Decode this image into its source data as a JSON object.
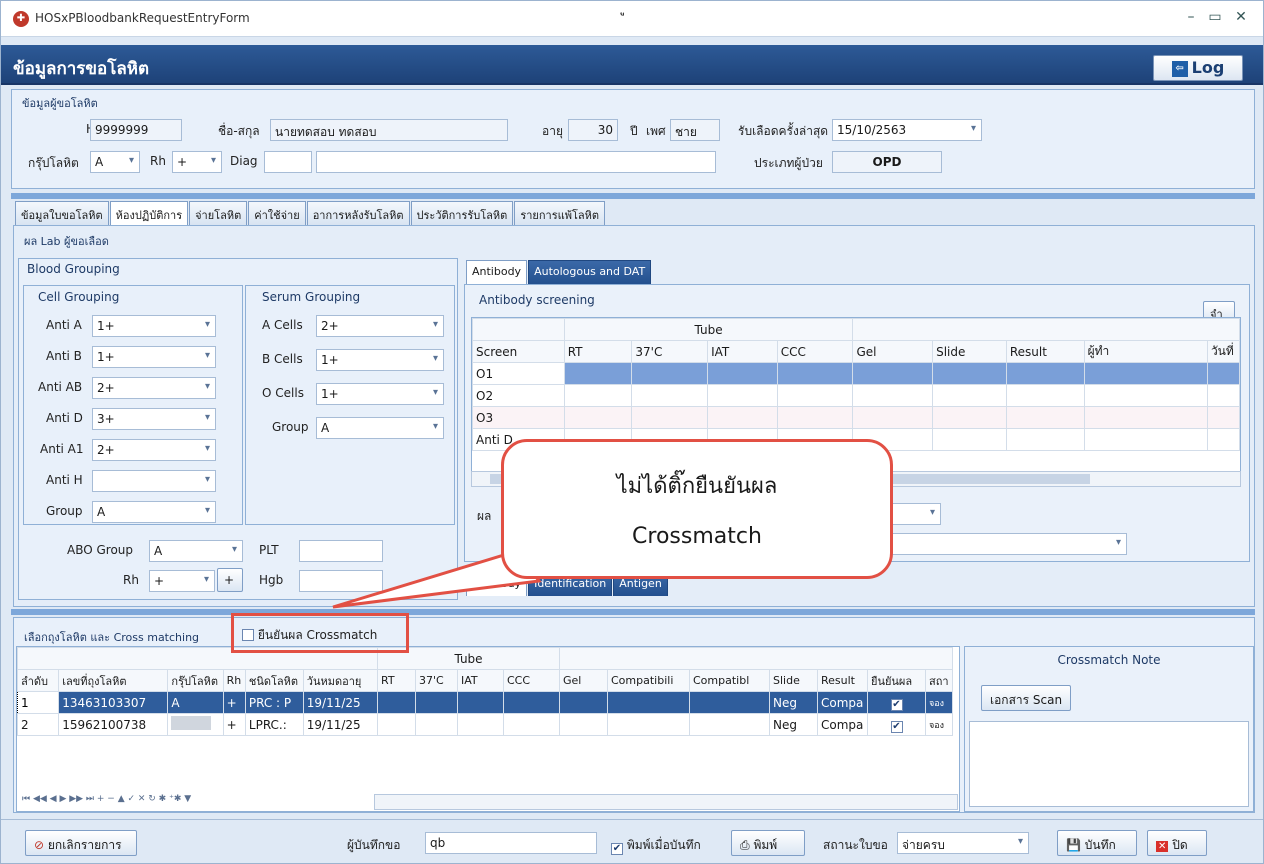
{
  "window": {
    "title": "HOSxPBloodbankRequestEntryForm",
    "top_mark": "ู"
  },
  "banner": {
    "title": "ข้อมูลการขอโลหิต",
    "log_label": "Log",
    "log_icon": "exit-icon"
  },
  "patient": {
    "group_title": "ข้อมูลผู้ขอโลหิต",
    "hn_label": "HN",
    "hn": "9999999",
    "name_label": "ชื่อ-สกุล",
    "name": "นายทดสอบ ทดสอบ",
    "age_label": "อายุ",
    "age": "30",
    "age_unit": "ปี",
    "sex_label": "เพศ",
    "sex": "ชาย",
    "last_label": "รับเลือดครั้งล่าสุด",
    "last_date": "15/10/2563",
    "blood_label": "กรุ๊ปโลหิต",
    "blood": "A",
    "rh_label": "Rh",
    "rh": "+",
    "diag_label": "Diag",
    "ptype_label": "ประเภทผู้ป่วย",
    "ptype": "OPD"
  },
  "main_tabs": [
    {
      "label": "ข้อมูลใบขอโลหิต"
    },
    {
      "label": "ห้องปฏิบัติการ"
    },
    {
      "label": "จ่ายโลหิต"
    },
    {
      "label": "ค่าใช้จ่าย"
    },
    {
      "label": "อาการหลังรับโลหิต"
    },
    {
      "label": "ประวัติการรับโลหิต"
    },
    {
      "label": "รายการแพ้โลหิต"
    }
  ],
  "lab": {
    "title": "ผล Lab ผู้ขอเลือด",
    "blood_grouping": "Blood Grouping",
    "cell_grouping": "Cell Grouping",
    "serum_grouping": "Serum Grouping",
    "cell": [
      {
        "label": "Anti A",
        "value": "1+"
      },
      {
        "label": "Anti B",
        "value": "1+"
      },
      {
        "label": "Anti AB",
        "value": "2+"
      },
      {
        "label": "Anti D",
        "value": "3+"
      },
      {
        "label": "Anti A1",
        "value": "2+"
      },
      {
        "label": "Anti H",
        "value": ""
      },
      {
        "label": "Group",
        "value": "A"
      }
    ],
    "serum": [
      {
        "label": "A Cells",
        "value": "2+"
      },
      {
        "label": "B Cells",
        "value": "1+"
      },
      {
        "label": "O Cells",
        "value": "1+"
      },
      {
        "label": "Group",
        "value": "A"
      }
    ],
    "abo_label": "ABO Group",
    "abo": "A",
    "rh_label": "Rh",
    "rh": "+",
    "rh_btn": "+",
    "plt_label": "PLT",
    "hgb_label": "Hgb"
  },
  "antibody": {
    "tabs": [
      {
        "label": "Antibody"
      },
      {
        "label": "Autologous and DAT"
      }
    ],
    "screen_title": "Antibody screening",
    "side_btn": "จำ",
    "tube_header": "Tube",
    "columns": [
      "Screen",
      "RT",
      "37'C",
      "IAT",
      "CCC",
      "Gel",
      "Slide",
      "Result",
      "ผู้ทำ",
      "วันที่"
    ],
    "rows": [
      "O1",
      "O2",
      "O3",
      "Anti D"
    ],
    "result_label": "ผล",
    "bottom_tabs": [
      {
        "label": "Antibody"
      },
      {
        "label": "Identification"
      },
      {
        "label": "Antigen"
      }
    ]
  },
  "callout": {
    "line1": "ไม่ได้ติ๊กยืนยันผล",
    "line2": "Crossmatch"
  },
  "cross": {
    "title": "เลือกถุงโลหิต และ Cross matching",
    "confirm_label": "ยืนยันผล Crossmatch",
    "tube_header": "Tube",
    "columns": [
      "ลำดับ",
      "เลขที่ถุงโลหิต",
      "กรุ๊ปโลหิต",
      "Rh",
      "ชนิดโลหิต",
      "วันหมดอายุ",
      "RT",
      "37'C",
      "IAT",
      "CCC",
      "Gel",
      "Compatibili",
      "Compatibl",
      "Slide",
      "Result",
      "ยืนยันผล",
      "สถา"
    ],
    "rows": [
      [
        "1",
        "13463103307",
        "A",
        "+",
        "PRC : P",
        "19/11/25",
        "",
        "",
        "",
        "",
        "",
        "",
        "",
        "Neg",
        "Compa",
        "✔",
        "จอง"
      ],
      [
        "2",
        "15962100738",
        "",
        "+",
        "LPRC.:",
        "19/11/25",
        "",
        "",
        "",
        "",
        "",
        "",
        "",
        "Neg",
        "Compa",
        "✔",
        "จอง"
      ]
    ],
    "nav": "⏮ ◀◀ ◀ ▶ ▶▶ ⏭ + − ▲ ✓ ✕ ↻ ✱ ⁺✱ ▼",
    "note_title": "Crossmatch Note",
    "scan_btn": "เอกสาร Scan"
  },
  "footer": {
    "cancel_btn": "ยกเลิกรายการ",
    "recorder_label": "ผู้บันทึกขอ",
    "recorder": "qb",
    "print_on_save": "พิมพ์เมื่อบันทึก",
    "print_btn": "พิมพ์",
    "status_label": "สถานะใบขอ",
    "status": "จ่ายครบ",
    "save_btn": "บันทึก",
    "close_btn": "ปิด"
  }
}
